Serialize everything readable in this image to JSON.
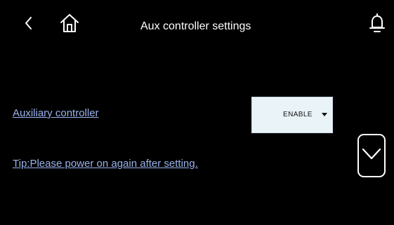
{
  "header": {
    "title": "Aux controller settings",
    "back_icon": "chevron-left-icon",
    "home_icon": "home-icon",
    "bell_icon": "bell-icon"
  },
  "settings": {
    "auxiliary_controller": {
      "label": "Auxiliary controller",
      "value": "ENABLE"
    },
    "tip": "Tip:Please power on again after setting."
  },
  "navigation": {
    "scroll_down_icon": "chevron-down-icon"
  },
  "colors": {
    "background": "#000000",
    "label_text": "#9ab2ec",
    "select_bg": "#e9f3f8"
  }
}
